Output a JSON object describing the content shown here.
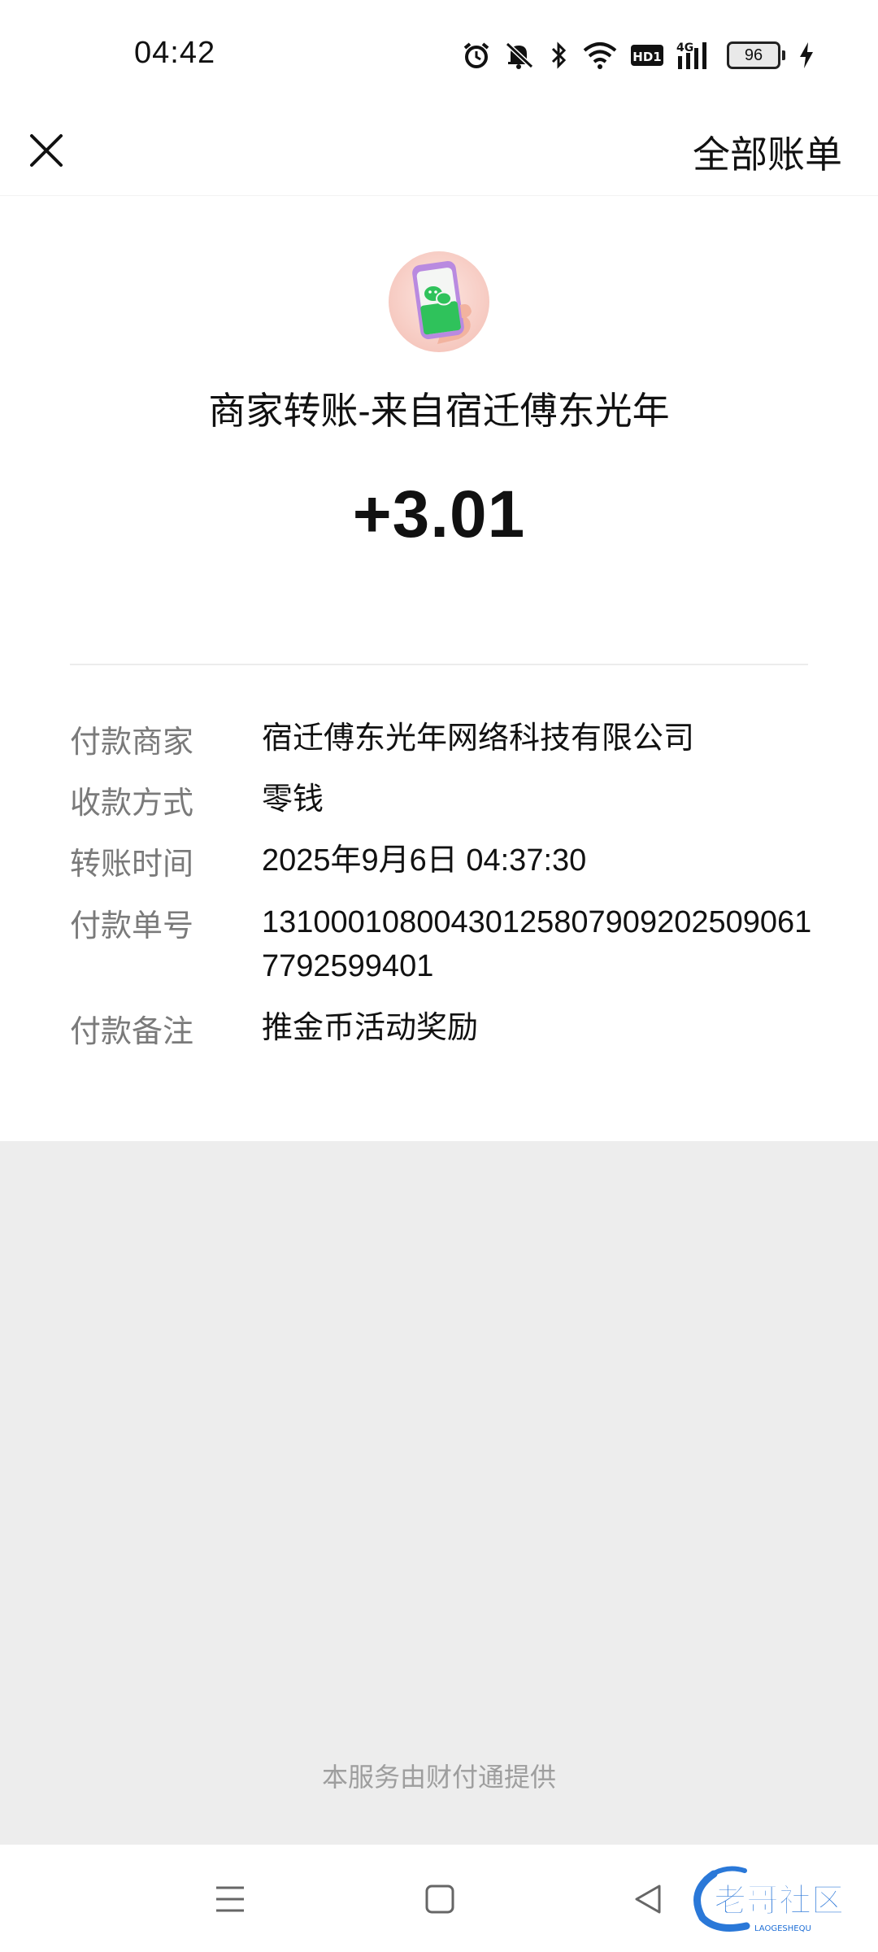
{
  "status_bar": {
    "time": "04:42",
    "battery": "96",
    "network": "4G",
    "hd_label": "HD1",
    "icons": [
      "alarm-icon",
      "mute-icon",
      "bluetooth-icon",
      "wifi-icon",
      "hd-icon",
      "signal-icon",
      "battery-icon",
      "charging-icon"
    ]
  },
  "header": {
    "close_icon": "close-icon",
    "all_bills_label": "全部账单"
  },
  "transaction": {
    "avatar_icon": "wechat-phone-icon",
    "title": "商家转账-来自宿迁傅东光年",
    "amount": "+3.01"
  },
  "details": [
    {
      "label": "付款商家",
      "value": "宿迁傅东光年网络科技有限公司"
    },
    {
      "label": "收款方式",
      "value": "零钱"
    },
    {
      "label": "转账时间",
      "value": "2025年9月6日 04:37:30"
    },
    {
      "label": "付款单号",
      "value": "131000108004301258079092025090617792599401"
    },
    {
      "label": "付款备注",
      "value": "推金币活动奖励"
    }
  ],
  "footer": {
    "provider_text": "本服务由财付通提供"
  },
  "navbar": {
    "icons": [
      "menu-icon",
      "home-icon",
      "back-icon"
    ]
  },
  "watermark": {
    "text": "老哥社区",
    "subtext": "LAOGESHEQU"
  }
}
